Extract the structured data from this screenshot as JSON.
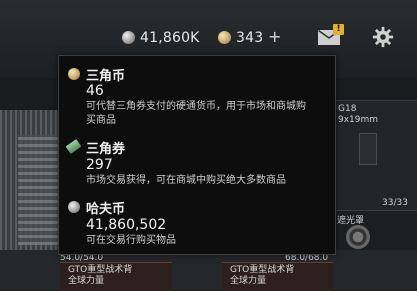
{
  "header": {
    "roubles_amount": "41,860K",
    "gp_amount": "343",
    "add_label": "+",
    "mail_badge": "!"
  },
  "tooltip": {
    "currencies": [
      {
        "name": "三角币",
        "amount": "46",
        "description_line1": "可代替三角券支付的硬通货币，用于市场和商城购",
        "description_line2": "买商品"
      },
      {
        "name": "三角券",
        "amount": "297",
        "description_line1": "市场交易获得，可在商城中购买绝大多数商品"
      },
      {
        "name": "哈夫币",
        "amount": "41,860,502",
        "description_line1": "可在交易行购买物品"
      }
    ]
  },
  "inventory": {
    "weapon_name": "G18",
    "weapon_caliber": "9x19mm",
    "ammo_count": "33/33",
    "attachment_label": "遮光罩",
    "cell_left_durability": "54.0/54.0",
    "cell_left_name": "GTO重型战术背",
    "cell_left_brand": "全球力量",
    "cell_right_durability": "68.0/68.0",
    "cell_right_name": "GTO重型战术背",
    "cell_right_brand": "全球力量"
  },
  "colors": {
    "accent_badge": "#e0b233",
    "tooltip_bg": "#0c0d0e"
  }
}
